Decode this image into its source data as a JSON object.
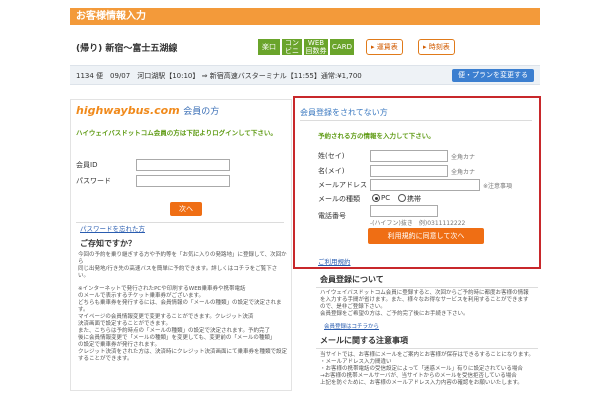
{
  "header": {
    "title": "お客様情報入力"
  },
  "route": {
    "title": "(帰り) 新宿～富士五湖線",
    "badges": [
      "楽口",
      "コンビニ",
      "WEB 回数券",
      "CARD"
    ],
    "buttons": [
      "運賃表",
      "時刻表"
    ]
  },
  "trip": {
    "info": "1134 便　09/07　河口湖駅【10:10】 ⇒ 新宿高速バスターミナル【11:55】通常:¥1,700",
    "change_button": "便・プランを変更する"
  },
  "member": {
    "logo_en": "highwaybus.com",
    "logo_jp": "会員の方",
    "note": "ハイウェイバスドットコム会員の方は下記よりログインして下さい。",
    "id_label": "会員ID",
    "password_label": "パスワード",
    "next_button": "次へ",
    "forgot_link": "パスワードを忘れた方",
    "info_title": "ご存知ですか？",
    "info_text": [
      "今回の予約を乗り継ぎする方や予約等を「お気に入りの発路地」に登録して、次回から",
      "同じ出発地/行き先の高速バスを簡単に予約できます。詳しくはコチラをご覧下さい。",
      "",
      "※インターネットで発行されたPCや印刷するWEB乗車券や携帯電話",
      "のメールで表示するチケット乗車券がございます。",
      "どちらも乗車券を発行するには、会員情報の「メールの種類」の設定で決定されます。",
      "マイページの会員情報変更で変更することができます。クレジット決済",
      "決済画面で設定することができます。",
      "また、こちらは予約時点の「メールの種類」の設定で決定されます。予約完了",
      "後に会員情報変更で「メールの種類」を変更しても、変更前の「メールの種類」",
      "の設定で乗車券が発行されます。",
      "クレジット決済をされた方は、決済時にクレジット決済画面にて乗車券を種類で設定",
      "することができます。"
    ]
  },
  "guest": {
    "title": "会員登録をされてない方",
    "note": "予約される方の情報を入力して下さい。",
    "sei_label": "姓(セイ)",
    "sei_hint": "全角カナ",
    "mei_label": "名(メイ)",
    "mei_hint": "全角カナ",
    "email_label": "メールアドレス",
    "email_hint": "※注意事項",
    "mailtype_label": "メールの種類",
    "mailtype_options": [
      "PC",
      "携帯"
    ],
    "phone_label": "電話番号",
    "phone_hint": "-(ハイフン)抜き　例)0311112222",
    "agree_button": "利用規約に同意して次へ",
    "terms_link": "ご利用規約"
  },
  "signup": {
    "title": "会員登録について",
    "text": [
      "ハイウェイバスドットコム会員に登録すると、次回からご予約時に都度お客様の情報",
      "を入力する手間が省けます。また、様々なお得なサービスを利用することができます",
      "ので、是非ご登録下さい。",
      "会員登録をご希望の方は、ご予約完了後にお手続き下さい。"
    ],
    "link": "会員登録はコチラから"
  },
  "mail": {
    "title": "メールに関する注意事項",
    "text": [
      "当サイトでは、お客様にメールをご案内とお客様が保存はできるすることになります。",
      "・メールアドレス入力間違い",
      "・お客様の携帯電話の受信設定によって「迷惑メール」有りに設定されている場合",
      "→お客様の携帯メールサーバが、当サイトからのメールを受信拒否している場合",
      "上記を防ぐために、お客様のメールアドレス入力内容の確認をお願いいたします。"
    ]
  }
}
